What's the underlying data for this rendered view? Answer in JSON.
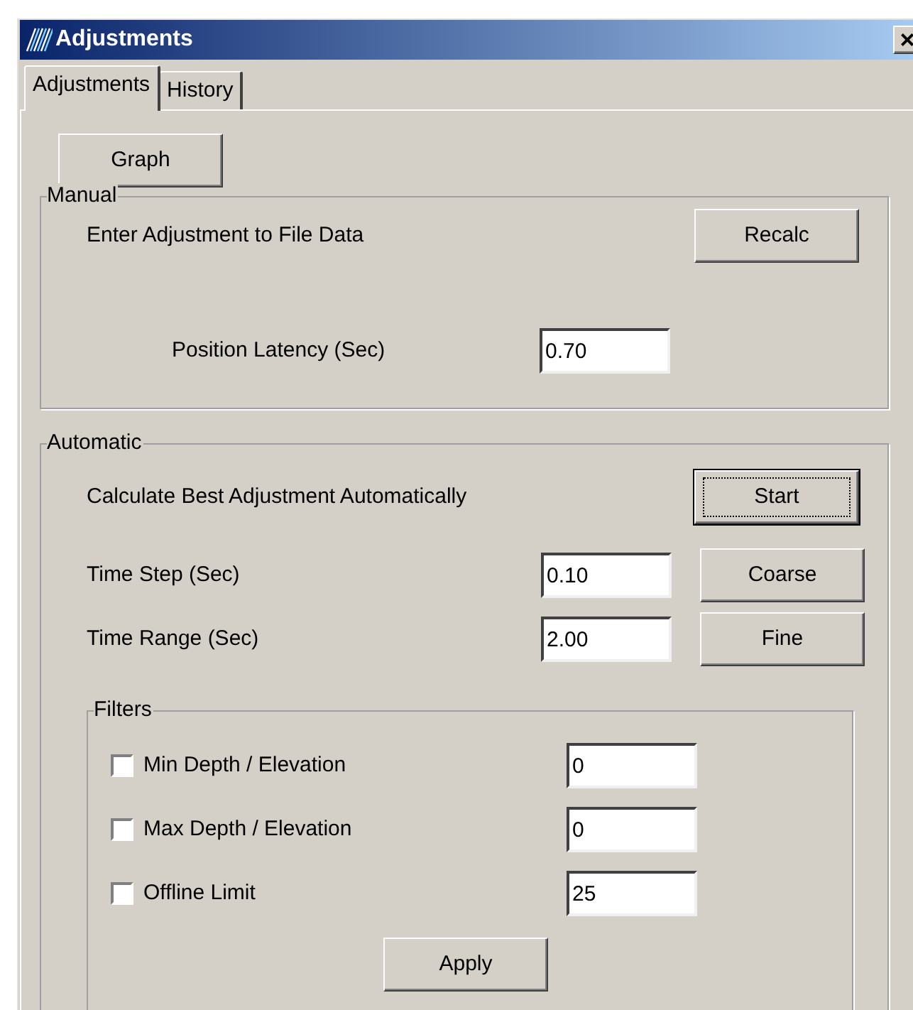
{
  "window": {
    "title": "Adjustments",
    "close_glyph": "×"
  },
  "tabs": [
    {
      "label": "Adjustments",
      "selected": true
    },
    {
      "label": "History",
      "selected": false
    }
  ],
  "graph_button": "Graph",
  "manual": {
    "title": "Manual",
    "description": "Enter Adjustment to File Data",
    "recalc_button": "Recalc",
    "latency": {
      "label": "Position Latency (Sec)",
      "value": "0.70"
    }
  },
  "automatic": {
    "title": "Automatic",
    "description": "Calculate Best Adjustment Automatically",
    "start_button": {
      "label": "Start",
      "focused": true
    },
    "fields": [
      {
        "label": "Time Step (Sec)",
        "value": "0.10",
        "button": "Coarse"
      },
      {
        "label": "Time Range (Sec)",
        "value": "2.00",
        "button": "Fine"
      }
    ],
    "filters": {
      "title": "Filters",
      "rows": [
        {
          "label": "Min Depth / Elevation",
          "checked": false,
          "value": "0"
        },
        {
          "label": "Max Depth / Elevation",
          "checked": false,
          "value": "0"
        },
        {
          "label": "Offline Limit",
          "checked": false,
          "value": "25"
        }
      ],
      "apply_button": "Apply"
    }
  }
}
